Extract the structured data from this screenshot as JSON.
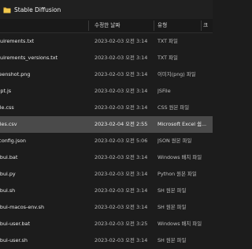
{
  "window": {
    "title": "Stable Diffusion",
    "title_icon": "folder-icon",
    "accent": "#e3b341"
  },
  "columns": {
    "name": "",
    "date": "수정한 날짜",
    "type": "유형",
    "size": "크"
  },
  "files": [
    {
      "name": "quirements.txt",
      "date": "2023-02-03 오전 3:14",
      "type": "TXT 파일"
    },
    {
      "name": "quirements_versions.txt",
      "date": "2023-02-03 오전 3:14",
      "type": "TXT 파일"
    },
    {
      "name": "reenshot.png",
      "date": "2023-02-03 오전 3:14",
      "type": "이미지(png) 파일"
    },
    {
      "name": "ript.js",
      "date": "2023-02-03 오전 3:14",
      "type": "JSFile"
    },
    {
      "name": "yle.css",
      "date": "2023-02-03 오전 3:14",
      "type": "CSS 원본 파일"
    },
    {
      "name": "yles.csv",
      "date": "2023-02-04 오전 2:55",
      "type": "Microsoft Excel 쉼...",
      "selected": true
    },
    {
      "name": "-config.json",
      "date": "2023-02-03 오전 5:06",
      "type": "JSON 원본 파일"
    },
    {
      "name": "ebui.bat",
      "date": "2023-02-03 오전 3:14",
      "type": "Windows 배치 파일"
    },
    {
      "name": "ebui.py",
      "date": "2023-02-03 오전 3:14",
      "type": "Python 원본 파일"
    },
    {
      "name": "ebui.sh",
      "date": "2023-02-03 오전 3:14",
      "type": "SH 원본 파일"
    },
    {
      "name": "ebui-macos-env.sh",
      "date": "2023-02-03 오전 3:14",
      "type": "SH 원본 파일"
    },
    {
      "name": "ebui-user.bat",
      "date": "2023-02-03 오전 3:25",
      "type": "Windows 배치 파일"
    },
    {
      "name": "ebui-user.sh",
      "date": "2023-02-03 오전 3:14",
      "type": "SH 원본 파일"
    }
  ]
}
